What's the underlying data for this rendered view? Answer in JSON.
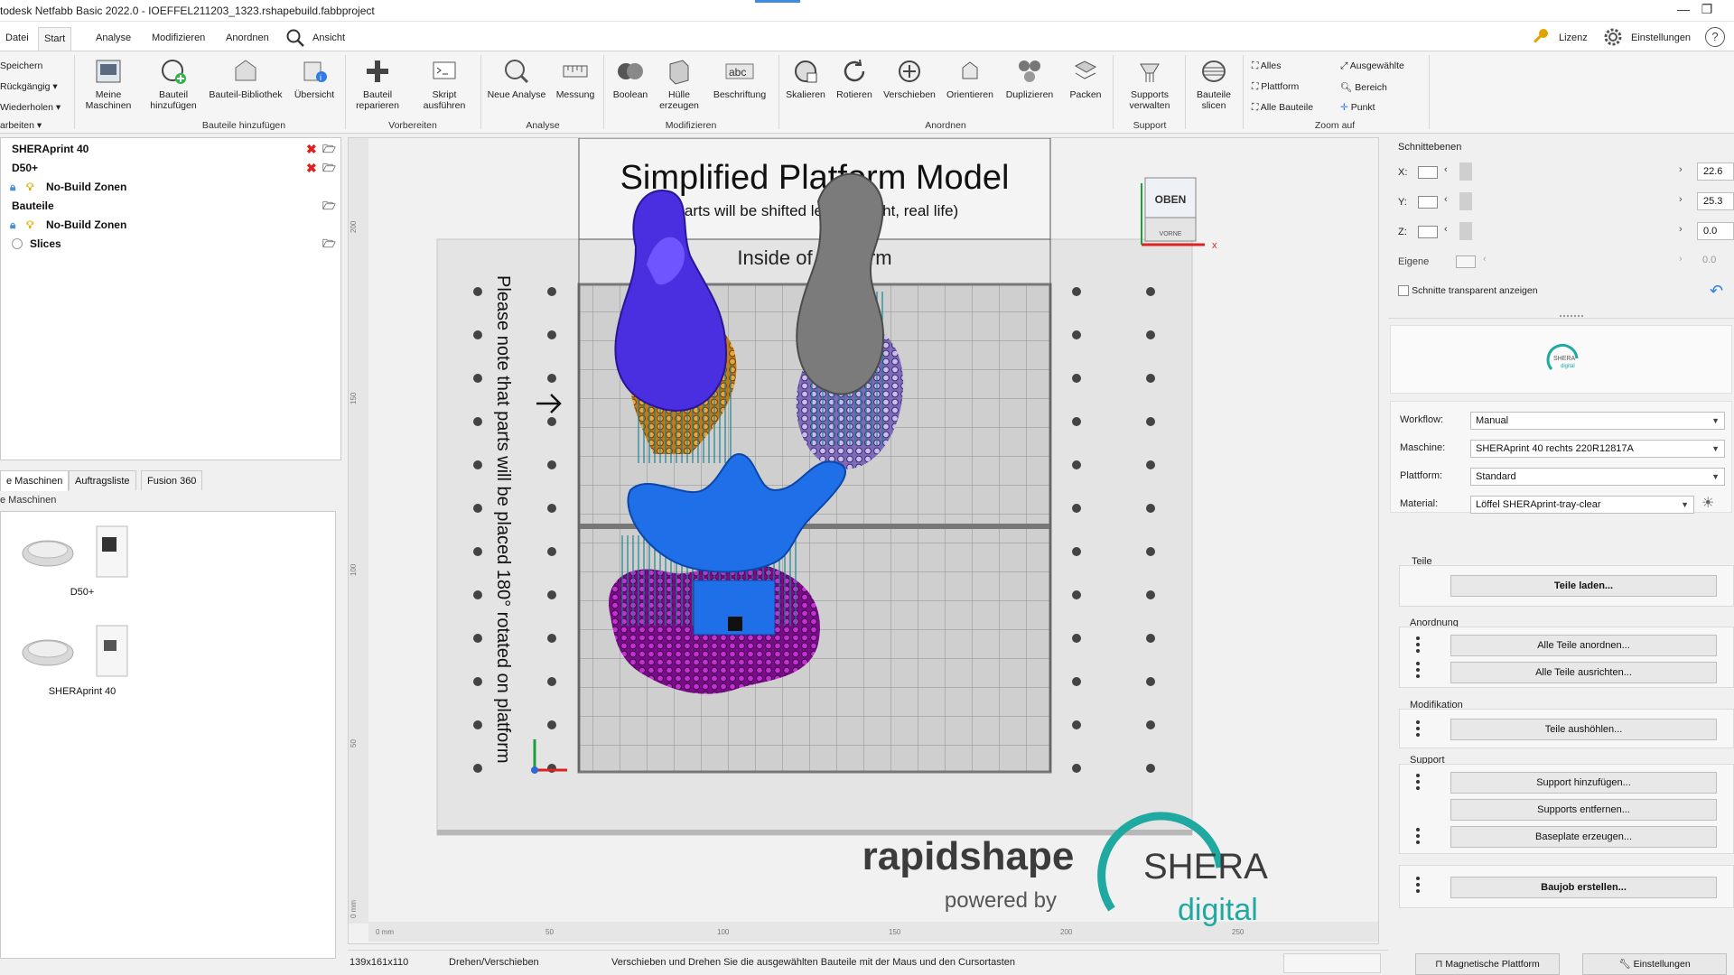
{
  "window": {
    "title": "todesk Netfabb Basic 2022.0 - IOEFFEL211203_1323.rshapebuild.fabbproject",
    "minimize_glyph": "—",
    "maximize_glyph": "❐"
  },
  "ribbon_tabs": [
    "Datei",
    "Start",
    "Analyse",
    "Modifizieren",
    "Anordnen",
    "Ansicht"
  ],
  "top_right": {
    "license": "Lizenz",
    "settings": "Einstellungen",
    "help": "?"
  },
  "quick_commands": [
    "Speichern",
    "Rückgängig",
    "Wiederholen",
    "arbeiten"
  ],
  "ribbon_groups": [
    {
      "label": "Bauteile hinzufügen",
      "buttons": [
        "Meine Maschinen",
        "Bauteil hinzufügen",
        "Bauteil-Bibliothek",
        "Übersicht"
      ]
    },
    {
      "label": "Vorbereiten",
      "buttons": [
        "Bauteil reparieren",
        "Skript ausführen"
      ]
    },
    {
      "label": "Analyse",
      "buttons": [
        "Neue Analyse",
        "Messung"
      ]
    },
    {
      "label": "Modifizieren",
      "buttons": [
        "Boolean",
        "Hülle erzeugen",
        "Beschriftung"
      ]
    },
    {
      "label": "Anordnen",
      "buttons": [
        "Skalieren",
        "Rotieren",
        "Verschieben",
        "Orientieren",
        "Duplizieren",
        "Packen"
      ]
    },
    {
      "label": "Support",
      "buttons": [
        "Supports verwalten"
      ]
    },
    {
      "label": "",
      "buttons": [
        "Bauteile slicen"
      ]
    },
    {
      "label": "Zoom auf",
      "buttons": [
        "Alles",
        "Plattform",
        "Alle Bauteile",
        "Ausgewählte",
        "Bereich",
        "Punkt"
      ]
    }
  ],
  "tree": [
    {
      "label": "SHERAprint 40"
    },
    {
      "label": "D50+"
    },
    {
      "label": "No-Build Zonen"
    },
    {
      "label": "Bauteile"
    },
    {
      "label": "No-Build Zonen"
    },
    {
      "label": "Slices"
    }
  ],
  "machines_tabs": [
    "e Maschinen",
    "Auftragsliste",
    "Fusion 360"
  ],
  "machines_heading": "e Maschinen",
  "machines": [
    {
      "name": "D50+"
    },
    {
      "name": "SHERAprint 40"
    }
  ],
  "viewport": {
    "plate_title": "Simplified Platform Model",
    "plate_subtitle": "(parts will be shifted left and right, real life)",
    "plate_side_text": "Inside of Platform",
    "rotated_note": "Please note that parts will be placed 180° rotated on platform",
    "view_cube_label": "OBEN",
    "view_cube_sub": "VORNE",
    "axis_x": "x",
    "brand_rapidshape": "rapidshape",
    "brand_powered": "powered by",
    "brand_shera": "SHERA",
    "brand_digital": "digital",
    "ruler_ticks_x": [
      "0 mm",
      "50",
      "100",
      "150",
      "200",
      "250"
    ],
    "ruler_ticks_y": [
      "200",
      "150",
      "100",
      "50",
      "0 mm"
    ]
  },
  "schnittebenen": {
    "title": "Schnittebenen",
    "x_label": "X:",
    "x_value": "22.6",
    "y_label": "Y:",
    "y_value": "25.3",
    "z_label": "Z:",
    "z_value": "0.0",
    "own_label": "Eigene",
    "own_value": "0.0",
    "transparent_label": "Schnitte transparent anzeigen"
  },
  "config": {
    "workflow_label": "Workflow:",
    "workflow_value": "Manual",
    "machine_label": "Maschine:",
    "machine_value": "SHERAprint 40 rechts 220R12817A",
    "platform_label": "Plattform:",
    "platform_value": "Standard",
    "material_label": "Material:",
    "material_value": "Löffel SHERAprint-tray-clear"
  },
  "sections": {
    "teile": "Teile",
    "teile_load": "Teile laden...",
    "anordnung": "Anordnung",
    "arrange_all": "Alle Teile anordnen...",
    "align_all": "Alle Teile ausrichten...",
    "modifikation": "Modifikation",
    "hollow": "Teile aushöhlen...",
    "support": "Support",
    "add_support": "Support hinzufügen...",
    "remove_support": "Supports entfernen...",
    "baseplate": "Baseplate erzeugen...",
    "buildjob": "Baujob erstellen...",
    "magnetic": "Magnetische Plattform",
    "settings": "Einstellungen"
  },
  "status": {
    "dims": "139x161x110",
    "mode": "Drehen/Verschieben",
    "hint": "Verschieben und Drehen Sie die ausgewählten Bauteile mit der Maus und den Cursortasten"
  },
  "colors": {
    "ribbon_bg": "#f5f5f5",
    "accent_blue": "#3f8be0",
    "part_violet": "#4a2fe0",
    "part_gray": "#7a7a7a",
    "part_blue": "#1f6fe8",
    "support_orange": "#e0a030",
    "support_purple": "#b020c0",
    "support_lilac": "#b8a8e8",
    "support_teal": "#1a7f90",
    "shera_teal": "#1fa9a0"
  }
}
